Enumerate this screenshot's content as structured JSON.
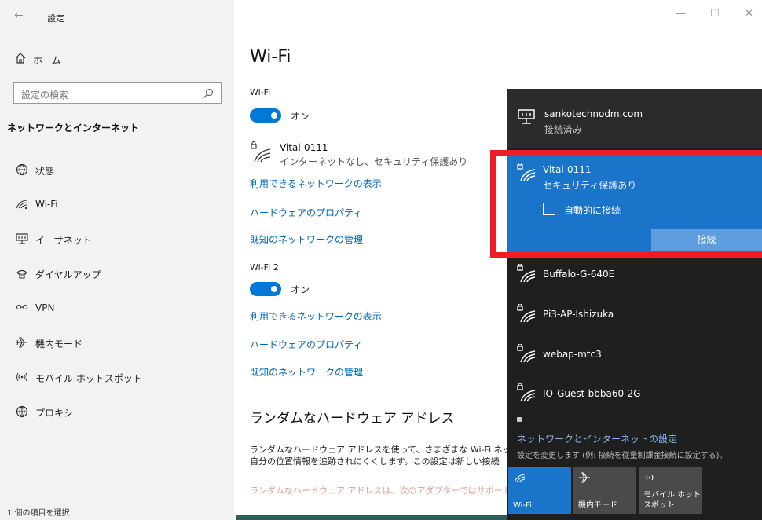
{
  "window": {
    "title": "設定",
    "status_text": "1 個の項目を選択"
  },
  "sidebar": {
    "home_label": "ホーム",
    "search_placeholder": "設定の検索",
    "section_title": "ネットワークとインターネット",
    "items": [
      {
        "label": "状態",
        "icon": "status-globe-icon"
      },
      {
        "label": "Wi-Fi",
        "icon": "wifi-icon"
      },
      {
        "label": "イーサネット",
        "icon": "ethernet-icon"
      },
      {
        "label": "ダイヤルアップ",
        "icon": "dialup-icon"
      },
      {
        "label": "VPN",
        "icon": "vpn-icon"
      },
      {
        "label": "機内モード",
        "icon": "airplane-icon"
      },
      {
        "label": "モバイル ホットスポット",
        "icon": "hotspot-icon"
      },
      {
        "label": "プロキシ",
        "icon": "proxy-globe-icon"
      }
    ]
  },
  "main": {
    "page_title": "Wi-Fi",
    "adapter1": {
      "label": "Wi-Fi",
      "toggle_label": "オン",
      "network_name": "Vital-0111",
      "network_status": "インターネットなし、セキュリティ保護あり",
      "links": [
        "利用できるネットワークの表示",
        "ハードウェアのプロパティ",
        "既知のネットワークの管理"
      ]
    },
    "adapter2": {
      "label": "Wi-Fi 2",
      "toggle_label": "オン",
      "links": [
        "利用できるネットワークの表示",
        "ハードウェアのプロパティ",
        "既知のネットワークの管理"
      ]
    },
    "random_hw": {
      "heading": "ランダムなハードウェア アドレス",
      "para_line1": "ランダムなハードウェア アドレスを使って、さまざまな Wi-Fi ネットワー",
      "para_line2": "自分の位置情報を追跡されにくくします。この設定は新しい接続",
      "para_line3": "ランダムなハードウェア アドレスは、次のアダプターではサポートされ"
    }
  },
  "flyout": {
    "connected": {
      "name": "sankotechnodm.com",
      "status": "接続済み"
    },
    "selected": {
      "name": "Vital-0111",
      "status": "セキュリティ保護あり",
      "auto_connect_label": "自動的に接続",
      "auto_connect_checked": false,
      "connect_button": "接続"
    },
    "networks": [
      "Buffalo-G-640E",
      "Pi3-AP-Ishizuka",
      "webap-mtc3",
      "IO-Guest-bbba60-2G"
    ],
    "settings_link": "ネットワークとインターネットの設定",
    "settings_sub": "設定を変更します (例: 接続を従量制課金接続に設定する)。",
    "quick_actions": [
      {
        "label": "Wi-Fi",
        "active": true
      },
      {
        "label": "機内モード",
        "active": false
      },
      {
        "label": "モバイル ホットスポット",
        "active": false
      }
    ]
  },
  "colors": {
    "accent": "#0078d7",
    "highlight": "#ee1c24",
    "flyout_bg": "#1f1f1f",
    "selected_bg": "#1a74c9"
  }
}
